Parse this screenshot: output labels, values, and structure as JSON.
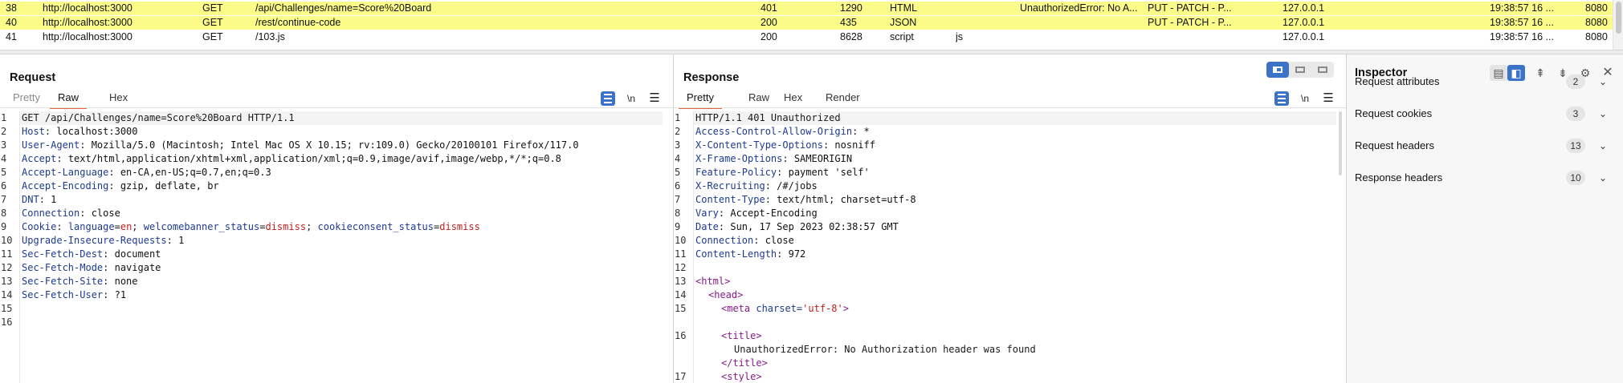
{
  "history": {
    "rows": [
      {
        "num": "38",
        "host": "http://localhost:3000",
        "method": "GET",
        "url": "/api/Challenges/name=Score%20Board",
        "status": "401",
        "length": "1290",
        "mime": "HTML",
        "ext": "",
        "title": "UnauthorizedError: No A...",
        "comment": "PUT - PATCH - P...",
        "ip": "127.0.0.1",
        "time": "19:38:57 16 ...",
        "port": "8080",
        "highlighted": true
      },
      {
        "num": "40",
        "host": "http://localhost:3000",
        "method": "GET",
        "url": "/rest/continue-code",
        "status": "200",
        "length": "435",
        "mime": "JSON",
        "ext": "",
        "title": "",
        "comment": "PUT - PATCH - P...",
        "ip": "127.0.0.1",
        "time": "19:38:57 16 ...",
        "port": "8080",
        "highlighted": true
      },
      {
        "num": "41",
        "host": "http://localhost:3000",
        "method": "GET",
        "url": "/103.js",
        "status": "200",
        "length": "8628",
        "mime": "script",
        "ext": "js",
        "title": "",
        "comment": "",
        "ip": "127.0.0.1",
        "time": "19:38:57 16 ...",
        "port": "8080",
        "highlighted": false
      }
    ]
  },
  "request": {
    "title": "Request",
    "tabs": [
      "Pretty",
      "Raw",
      "Hex"
    ],
    "active_tab": "Raw",
    "newline_label": "\\n",
    "menu_icon": "hamburger-icon",
    "line_numbers": [
      "1",
      "2",
      "3",
      "4",
      "5",
      "6",
      "7",
      "8",
      "9",
      "10",
      "11",
      "12",
      "13",
      "14",
      "15",
      "16"
    ],
    "request_line": "GET /api/Challenges/name=Score%20Board HTTP/1.1",
    "headers": [
      {
        "name": "Host",
        "value": "localhost:3000"
      },
      {
        "name": "User-Agent",
        "value": "Mozilla/5.0 (Macintosh; Intel Mac OS X 10.15; rv:109.0) Gecko/20100101 Firefox/117.0"
      },
      {
        "name": "Accept",
        "value": "text/html,application/xhtml+xml,application/xml;q=0.9,image/avif,image/webp,*/*;q=0.8"
      },
      {
        "name": "Accept-Language",
        "value": "en-CA,en-US;q=0.7,en;q=0.3"
      },
      {
        "name": "Accept-Encoding",
        "value": "gzip, deflate, br"
      },
      {
        "name": "DNT",
        "value": "1"
      },
      {
        "name": "Connection",
        "value": "close"
      }
    ],
    "cookie_label": "Cookie",
    "cookies": [
      {
        "name": "language",
        "value": "en"
      },
      {
        "name": "welcomebanner_status",
        "value": "dismiss"
      },
      {
        "name": "cookieconsent_status",
        "value": "dismiss"
      }
    ],
    "headers_after": [
      {
        "name": "Upgrade-Insecure-Requests",
        "value": "1"
      },
      {
        "name": "Sec-Fetch-Dest",
        "value": "document"
      },
      {
        "name": "Sec-Fetch-Mode",
        "value": "navigate"
      },
      {
        "name": "Sec-Fetch-Site",
        "value": "none"
      },
      {
        "name": "Sec-Fetch-User",
        "value": "?1"
      }
    ]
  },
  "response": {
    "title": "Response",
    "tabs": [
      "Pretty",
      "Raw",
      "Hex",
      "Render"
    ],
    "active_tab": "Pretty",
    "newline_label": "\\n",
    "status_line": "HTTP/1.1 401 Unauthorized",
    "headers": [
      {
        "name": "Access-Control-Allow-Origin",
        "value": "*"
      },
      {
        "name": "X-Content-Type-Options",
        "value": "nosniff"
      },
      {
        "name": "X-Frame-Options",
        "value": "SAMEORIGIN"
      },
      {
        "name": "Feature-Policy",
        "value": "payment 'self'"
      },
      {
        "name": "X-Recruiting",
        "value": "/#/jobs"
      },
      {
        "name": "Content-Type",
        "value": "text/html; charset=utf-8"
      },
      {
        "name": "Vary",
        "value": "Accept-Encoding"
      },
      {
        "name": "Date",
        "value": "Sun, 17 Sep 2023 02:38:57 GMT"
      },
      {
        "name": "Connection",
        "value": "close"
      },
      {
        "name": "Content-Length",
        "value": "972"
      }
    ],
    "body": {
      "html_open": "<html>",
      "head_open": "<head>",
      "meta_tag": "<meta",
      "meta_attr": "charset=",
      "meta_val": "'utf-8'",
      "meta_close": ">",
      "title_open": "<title>",
      "title_text": "UnauthorizedError: No Authorization header was found",
      "title_close": "</title>",
      "style_open": "<style>"
    },
    "body_line_numbers": [
      "13",
      "14",
      "15",
      "16",
      "17"
    ]
  },
  "inspector": {
    "title": "Inspector",
    "sections": [
      {
        "label": "Request attributes",
        "count": "2"
      },
      {
        "label": "Request cookies",
        "count": "3"
      },
      {
        "label": "Request headers",
        "count": "13"
      },
      {
        "label": "Response headers",
        "count": "10"
      }
    ]
  },
  "colors": {
    "highlight_row": "#fbfb8a",
    "accent_blue": "#3b73c9",
    "active_tab_underline": "#e8663d",
    "header_name": "#1d3a8f",
    "cookie_value": "#c11f1f"
  }
}
